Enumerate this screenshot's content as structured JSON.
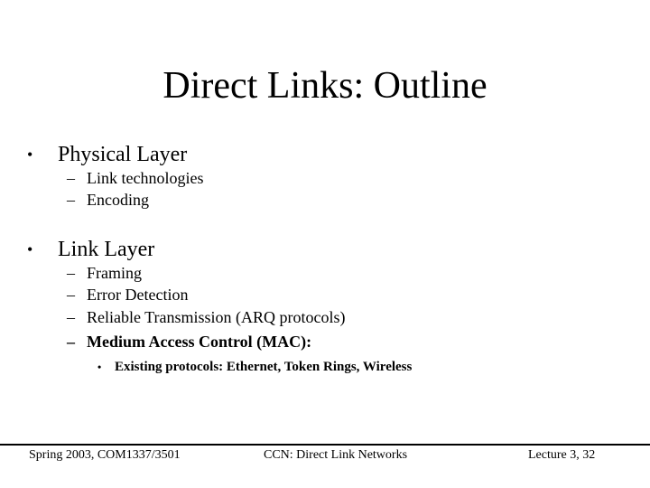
{
  "slide": {
    "title": "Direct Links: Outline",
    "outline": [
      {
        "bullet": "•",
        "label": "Physical Layer",
        "subitems": [
          {
            "dash": "–",
            "label": "Link technologies"
          },
          {
            "dash": "–",
            "label": "Encoding"
          }
        ]
      },
      {
        "bullet": "•",
        "label": "Link Layer",
        "subitems": [
          {
            "dash": "–",
            "label": "Framing"
          },
          {
            "dash": "–",
            "label": "Error Detection"
          },
          {
            "dash": "–",
            "label": "Reliable Transmission (ARQ protocols)"
          },
          {
            "dash": "–",
            "label": "Medium Access Control (MAC):",
            "bold": true,
            "subitems": [
              {
                "dot": "•",
                "label": "Existing protocols: Ethernet, Token Rings, Wireless",
                "bold": true
              }
            ]
          }
        ]
      }
    ],
    "footer": {
      "left": "Spring 2003, COM1337/3501",
      "center": "CCN: Direct Link Networks",
      "right": "Lecture 3, 32"
    }
  }
}
